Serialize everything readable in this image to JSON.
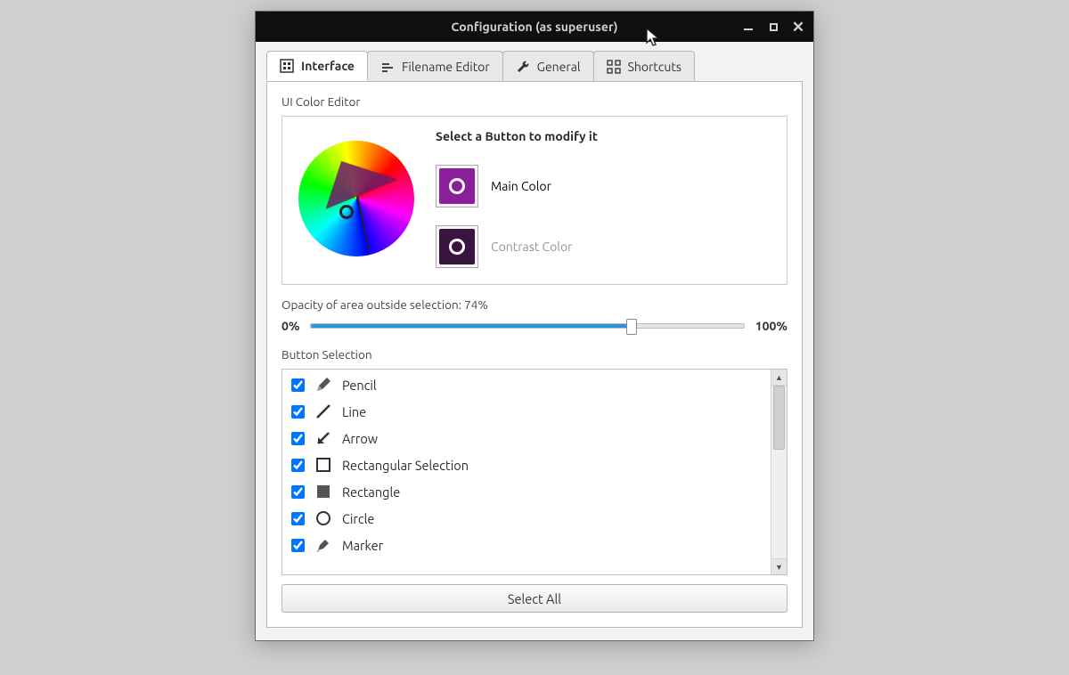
{
  "window": {
    "title": "Configuration (as superuser)"
  },
  "tabs": [
    {
      "label": "Interface"
    },
    {
      "label": "Filename Editor"
    },
    {
      "label": "General"
    },
    {
      "label": "Shortcuts"
    }
  ],
  "colorEditor": {
    "heading": "UI Color Editor",
    "instruction": "Select a Button to modify it",
    "mainLabel": "Main Color",
    "contrastLabel": "Contrast Color",
    "mainColor": "#8a1f9c",
    "contrastColor": "#3a1440"
  },
  "opacity": {
    "label": "Opacity of area outside selection: 74%",
    "min": "0%",
    "max": "100%",
    "value": 74
  },
  "buttonSelection": {
    "heading": "Button Selection",
    "items": [
      {
        "label": "Pencil",
        "icon": "pencil",
        "checked": true
      },
      {
        "label": "Line",
        "icon": "line",
        "checked": true
      },
      {
        "label": "Arrow",
        "icon": "arrow",
        "checked": true
      },
      {
        "label": "Rectangular Selection",
        "icon": "rect-outline",
        "checked": true
      },
      {
        "label": "Rectangle",
        "icon": "rect-fill",
        "checked": true
      },
      {
        "label": "Circle",
        "icon": "circle",
        "checked": true
      },
      {
        "label": "Marker",
        "icon": "marker",
        "checked": true
      }
    ],
    "selectAll": "Select All"
  }
}
